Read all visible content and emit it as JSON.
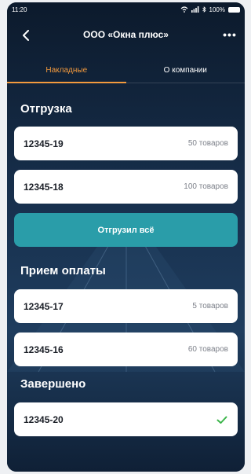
{
  "status": {
    "time": "11:20",
    "battery": "100%"
  },
  "header": {
    "title": "ООО «Окна плюс»"
  },
  "tabs": [
    {
      "label": "Накладные",
      "active": true
    },
    {
      "label": "О компании",
      "active": false
    }
  ],
  "shipment": {
    "title": "Отгрузка",
    "items": [
      {
        "id": "12345-19",
        "count": "50 товаров"
      },
      {
        "id": "12345-18",
        "count": "100 товаров"
      }
    ],
    "button_label": "Отгрузил всё"
  },
  "payment": {
    "title": "Прием оплаты",
    "items": [
      {
        "id": "12345-17",
        "count": "5 товаров"
      },
      {
        "id": "12345-16",
        "count": "60 товаров"
      }
    ]
  },
  "done": {
    "title": "Завершено",
    "items": [
      {
        "id": "12345-20"
      }
    ]
  },
  "colors": {
    "accent": "#f39a3d",
    "primary": "#2a9da9",
    "check": "#3bb54a",
    "background": "#0f2036"
  },
  "icons": {
    "back": "chevron-left-icon",
    "more": "more-icon",
    "done": "check-icon",
    "wifi": "wifi-icon",
    "signal": "signal-icon",
    "bluetooth": "bluetooth-icon",
    "battery": "battery-icon"
  }
}
